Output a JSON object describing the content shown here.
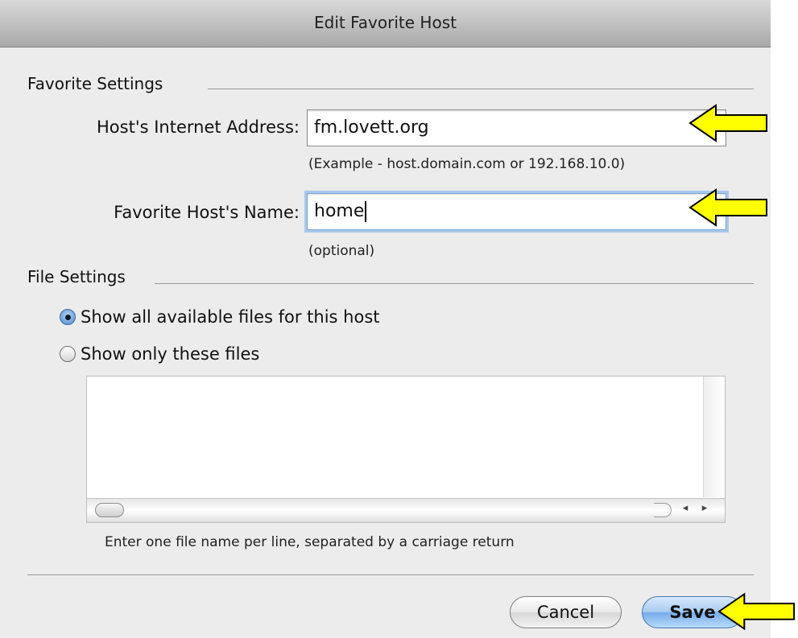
{
  "window": {
    "title": "Edit Favorite Host"
  },
  "favorite_settings": {
    "heading": "Favorite Settings",
    "address_label": "Host's Internet Address:",
    "address_value": "fm.lovett.org",
    "address_hint": "(Example - host.domain.com or 192.168.10.0)",
    "name_label": "Favorite Host's Name:",
    "name_value": "home",
    "name_hint": "(optional)"
  },
  "file_settings": {
    "heading": "File Settings",
    "options": [
      {
        "label": "Show all available files for this host",
        "selected": true
      },
      {
        "label": "Show only these files",
        "selected": false
      }
    ],
    "files_text": "",
    "instruction": "Enter one file name per line, separated by a carriage return"
  },
  "buttons": {
    "cancel": "Cancel",
    "save": "Save"
  },
  "annotation": {
    "arrow_color": "#ffff00",
    "arrow_stroke": "#000000"
  }
}
